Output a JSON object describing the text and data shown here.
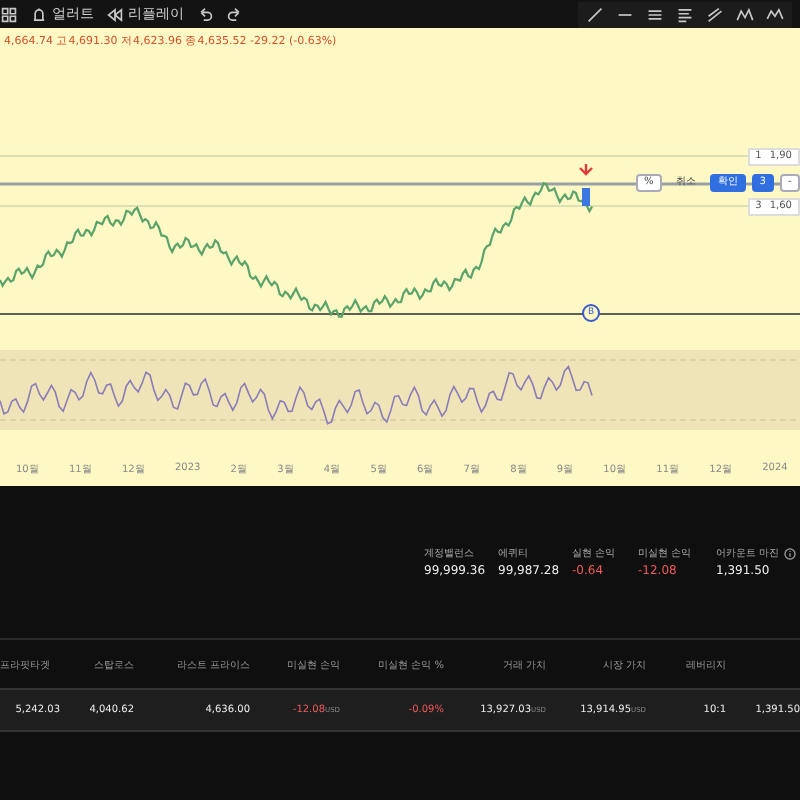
{
  "toolbar": {
    "items": [
      {
        "kind": "grid"
      },
      {
        "kind": "alert",
        "label": "얼러트"
      },
      {
        "kind": "replay",
        "label": "리플레이"
      },
      {
        "kind": "undo"
      },
      {
        "kind": "redo"
      }
    ]
  },
  "chart": {
    "ohlc": "4,664.74 고4,691.30 저4,623.96 종4,635.52 -29.22 (-0.63%)",
    "price_tags": [
      {
        "qty": "1",
        "price": "1,90"
      },
      {
        "qty": "3",
        "price": "1,60"
      }
    ],
    "order_panel": {
      "percent": "%",
      "cancel": "취소",
      "confirm": "확인",
      "quantity": "3",
      "minus": "-"
    },
    "marker": "B",
    "x_labels": [
      "10월",
      "11월",
      "12월",
      "2023",
      "2월",
      "3월",
      "4월",
      "5월",
      "6월",
      "7월",
      "8월",
      "9월",
      "10월",
      "11월",
      "12월",
      "2024"
    ]
  },
  "account": [
    {
      "label": "계정밸런스",
      "value": "99,999.36",
      "negative": false
    },
    {
      "label": "에퀴티",
      "value": "99,987.28",
      "negative": false
    },
    {
      "label": "실현 손익",
      "value": "-0.64",
      "negative": true
    },
    {
      "label": "미실현 손익",
      "value": "-12.08",
      "negative": true
    },
    {
      "label": "어카운트 마진",
      "value": "1,391.50",
      "negative": false,
      "info": true
    }
  ],
  "positions": {
    "columns": [
      "프라핏타겟",
      "스탑로스",
      "라스트 프라이스",
      "미실현 손익",
      "미실현 손익 %",
      "거래 가치",
      "시장 가치",
      "레버리지"
    ],
    "rows": [
      [
        {
          "text": "5,242.03"
        },
        {
          "text": "4,040.62"
        },
        {
          "text": "4,636.00"
        },
        {
          "text": "-12.08",
          "unit": "USD",
          "negative": true
        },
        {
          "text": "-0.09%",
          "negative": true
        },
        {
          "text": "13,927.03",
          "unit": "USD"
        },
        {
          "text": "13,914.95",
          "unit": "USD"
        },
        {
          "text": "10:1"
        },
        {
          "text": "1,391.50"
        }
      ]
    ]
  }
}
